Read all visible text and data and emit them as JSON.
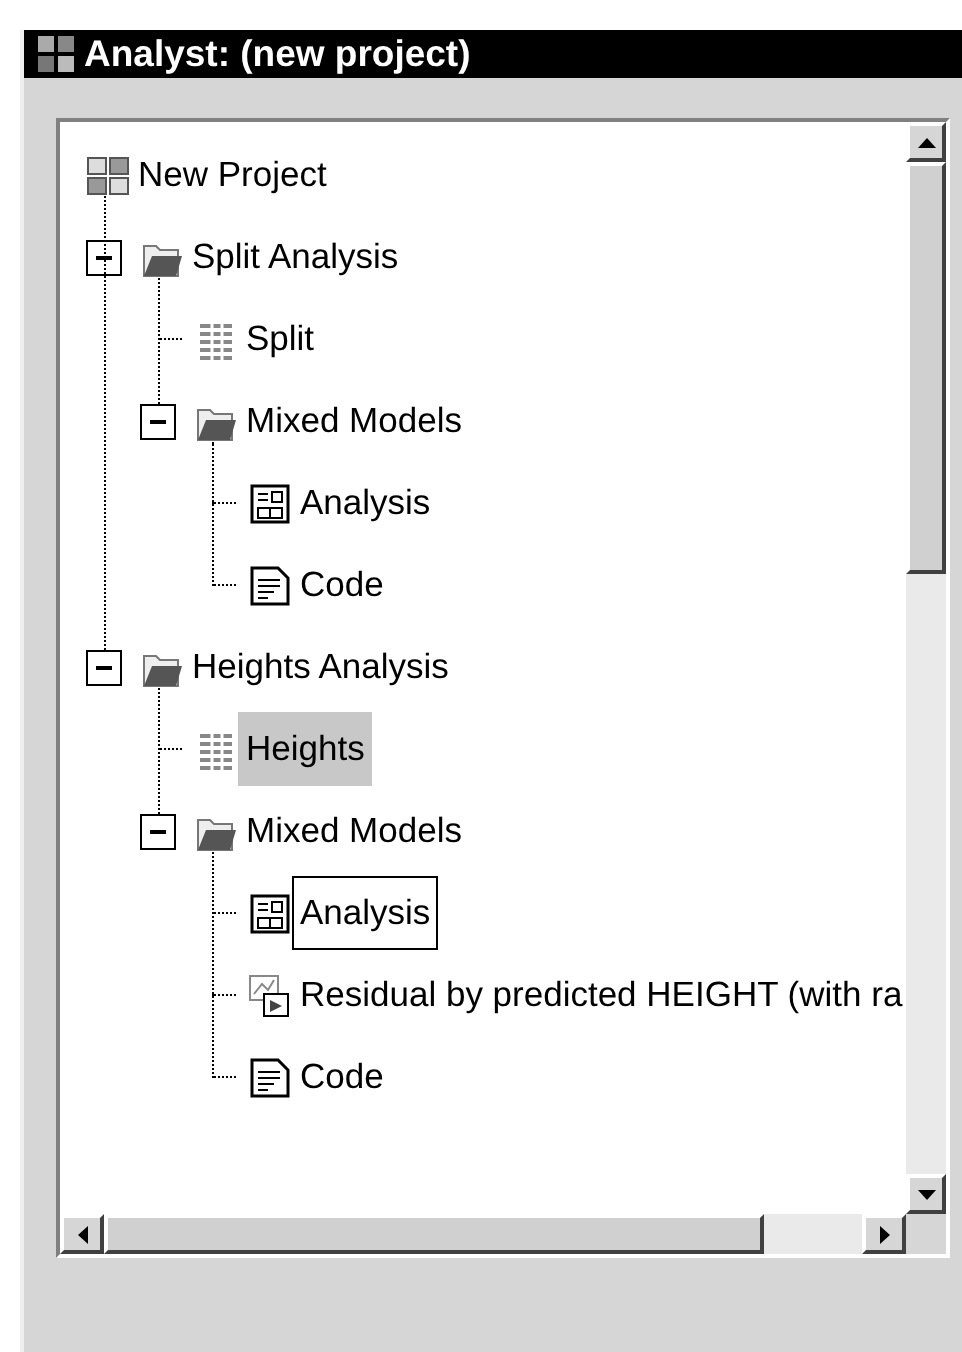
{
  "window": {
    "title": "Analyst: (new project)"
  },
  "tree": [
    {
      "label": "New Project",
      "kind": "project",
      "selected": false,
      "focused": false,
      "children": [
        {
          "label": "Split Analysis",
          "kind": "folder",
          "selected": false,
          "focused": false,
          "expanded": true,
          "children": [
            {
              "label": "Split",
              "kind": "table",
              "selected": false,
              "focused": false
            },
            {
              "label": "Mixed Models",
              "kind": "folder",
              "selected": false,
              "focused": false,
              "expanded": true,
              "children": [
                {
                  "label": "Analysis",
                  "kind": "analysis",
                  "selected": false,
                  "focused": false
                },
                {
                  "label": "Code",
                  "kind": "code",
                  "selected": false,
                  "focused": false
                }
              ]
            }
          ]
        },
        {
          "label": "Heights Analysis",
          "kind": "folder",
          "selected": false,
          "focused": false,
          "expanded": true,
          "children": [
            {
              "label": "Heights",
              "kind": "table",
              "selected": true,
              "focused": false
            },
            {
              "label": "Mixed Models",
              "kind": "folder",
              "selected": false,
              "focused": false,
              "expanded": true,
              "children": [
                {
                  "label": "Analysis",
                  "kind": "analysis",
                  "selected": false,
                  "focused": true
                },
                {
                  "label": "Residual by predicted HEIGHT (with ra",
                  "kind": "graph",
                  "selected": false,
                  "focused": false
                },
                {
                  "label": "Code",
                  "kind": "code",
                  "selected": false,
                  "focused": false
                }
              ]
            }
          ]
        }
      ]
    }
  ]
}
